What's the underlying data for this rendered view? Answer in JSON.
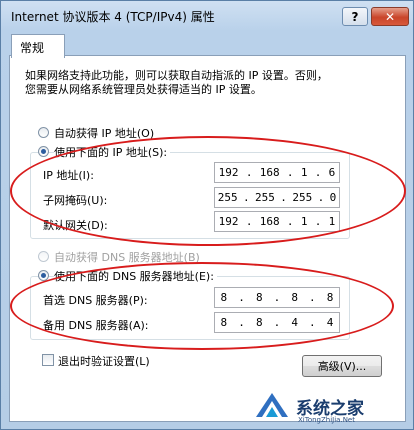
{
  "window": {
    "title": "Internet 协议版本 4 (TCP/IPv4) 属性",
    "help_label": "?",
    "close_label": "✕"
  },
  "tabs": [
    {
      "label": "常规"
    }
  ],
  "description": {
    "line1": "如果网络支持此功能，则可以获取自动指派的 IP 设置。否则，",
    "line2": "您需要从网络系统管理员处获得适当的 IP 设置。"
  },
  "ip_section": {
    "auto_label": "自动获得 IP 地址(O)",
    "manual_label": "使用下面的 IP 地址(S):",
    "selected": "manual",
    "fields": [
      {
        "label": "IP 地址(I):",
        "octets": [
          "192",
          "168",
          "1",
          "6"
        ]
      },
      {
        "label": "子网掩码(U):",
        "octets": [
          "255",
          "255",
          "255",
          "0"
        ]
      },
      {
        "label": "默认网关(D):",
        "octets": [
          "192",
          "168",
          "1",
          "1"
        ]
      }
    ]
  },
  "dns_section": {
    "auto_label": "自动获得 DNS 服务器地址(B)",
    "manual_label": "使用下面的 DNS 服务器地址(E):",
    "selected": "manual",
    "fields": [
      {
        "label": "首选 DNS 服务器(P):",
        "octets": [
          "8",
          "8",
          "8",
          "8"
        ]
      },
      {
        "label": "备用 DNS 服务器(A):",
        "octets": [
          "8",
          "8",
          "4",
          "4"
        ]
      }
    ]
  },
  "footer": {
    "validate_label": "退出时验证设置(L)",
    "validate_checked": false,
    "advanced_label": "高级(V)..."
  },
  "watermark": {
    "text": "系统之家",
    "sub": "XiTongZhiJia.Net"
  },
  "colors": {
    "highlight": "#d81c1c",
    "window_bg": "#b9d1ea"
  }
}
